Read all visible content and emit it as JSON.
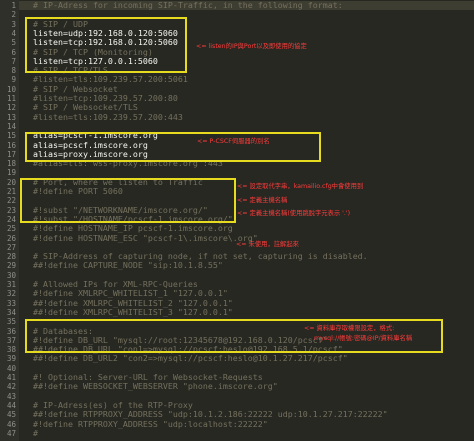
{
  "editor": {
    "lines": [
      {
        "n": "1",
        "text": "# IP-Adress for incoming SIP-Traffic, in the following format:",
        "kind": "comment",
        "highlight": true
      },
      {
        "n": "2",
        "text": "",
        "kind": "comment"
      },
      {
        "n": "3",
        "text": "# SIP / UDP",
        "kind": "comment"
      },
      {
        "n": "4",
        "text": "listen=udp:192.168.0.120:5060",
        "kind": "active"
      },
      {
        "n": "5",
        "text": "listen=tcp:192.168.0.120:5060",
        "kind": "active"
      },
      {
        "n": "6",
        "text": "# SIP / TCP (Monitoring)",
        "kind": "comment"
      },
      {
        "n": "7",
        "text": "listen=tcp:127.0.0.1:5060",
        "kind": "active"
      },
      {
        "n": "8",
        "text": "# SIP / TCP/TLS",
        "kind": "comment"
      },
      {
        "n": "9",
        "text": "#listen=tls:109.239.57.200:5061",
        "kind": "comment"
      },
      {
        "n": "10",
        "text": "# SIP / Websocket",
        "kind": "comment"
      },
      {
        "n": "11",
        "text": "#listen=tcp:109.239.57.200:80",
        "kind": "comment"
      },
      {
        "n": "12",
        "text": "# SIP / Websocket/TLS",
        "kind": "comment"
      },
      {
        "n": "13",
        "text": "#listen=tls:109.239.57.200:443",
        "kind": "comment"
      },
      {
        "n": "14",
        "text": "",
        "kind": "comment"
      },
      {
        "n": "15",
        "text": "alias=pcscf-1.imscore.org",
        "kind": "active"
      },
      {
        "n": "16",
        "text": "alias=pcscf.imscore.org",
        "kind": "active"
      },
      {
        "n": "17",
        "text": "alias=proxy.imscore.org",
        "kind": "active"
      },
      {
        "n": "18",
        "text": "#alias=tls:\"wss-proxy.imscore.org\":443",
        "kind": "comment"
      },
      {
        "n": "19",
        "text": "",
        "kind": "comment"
      },
      {
        "n": "20",
        "text": "# Port, where we listen to Traffic",
        "kind": "comment"
      },
      {
        "n": "21",
        "text": "#!define PORT 5060",
        "kind": "comment"
      },
      {
        "n": "22",
        "text": "",
        "kind": "comment"
      },
      {
        "n": "23",
        "text": "#!subst \"/NETWORKNAME/imscore.org/\"",
        "kind": "comment"
      },
      {
        "n": "24",
        "text": "#!subst \"/HOSTNAME/pcscf-1.imscore.org/\"",
        "kind": "comment"
      },
      {
        "n": "25",
        "text": "#!define HOSTNAME_IP pcscf-1.imscore.org",
        "kind": "comment"
      },
      {
        "n": "26",
        "text": "#!define HOSTNAME_ESC \"pcscf-1\\.imscore\\.org\"",
        "kind": "comment"
      },
      {
        "n": "27",
        "text": "",
        "kind": "comment"
      },
      {
        "n": "28",
        "text": "# SIP-Address of capturing node, if not set, capturing is disabled.",
        "kind": "comment"
      },
      {
        "n": "29",
        "text": "##!define CAPTURE_NODE \"sip:10.1.8.55\"",
        "kind": "comment"
      },
      {
        "n": "30",
        "text": "",
        "kind": "comment"
      },
      {
        "n": "31",
        "text": "# Allowed IPs for XML-RPC-Queries",
        "kind": "comment"
      },
      {
        "n": "32",
        "text": "#!define XMLRPC_WHITELIST_1 \"127.0.0.1\"",
        "kind": "comment"
      },
      {
        "n": "33",
        "text": "##!define XMLRPC_WHITELIST_2 \"127.0.0.1\"",
        "kind": "comment"
      },
      {
        "n": "34",
        "text": "##!define XMLRPC_WHITELIST_3 \"127.0.0.1\"",
        "kind": "comment"
      },
      {
        "n": "35",
        "text": "",
        "kind": "comment"
      },
      {
        "n": "36",
        "text": "# Databases:",
        "kind": "comment"
      },
      {
        "n": "37",
        "text": "#!define DB_URL \"mysql://root:12345678@192.168.0.120/pcscf\"",
        "kind": "comment"
      },
      {
        "n": "38",
        "text": "##!define DB_URL \"con1=>mysql://pcscf:heslo@192.168.5.1/pcscf\"",
        "kind": "comment"
      },
      {
        "n": "39",
        "text": "##!define DB_URL2 \"con2=>mysql://pcscf:heslo@10.1.27.217/pcscf\"",
        "kind": "comment"
      },
      {
        "n": "40",
        "text": "",
        "kind": "comment"
      },
      {
        "n": "41",
        "text": "#! Optional: Server-URL for Websocket-Requests",
        "kind": "comment"
      },
      {
        "n": "42",
        "text": "##!define WEBSOCKET_WEBSERVER \"phone.imscore.org\"",
        "kind": "comment"
      },
      {
        "n": "43",
        "text": "",
        "kind": "comment"
      },
      {
        "n": "44",
        "text": "# IP-Adress(es) of the RTP-Proxy",
        "kind": "comment"
      },
      {
        "n": "45",
        "text": "##!define RTPPROXY_ADDRESS \"udp:10.1.2.186:22222 udp:10.1.27.217:22222\"",
        "kind": "comment"
      },
      {
        "n": "46",
        "text": "#!define RTPPROXY_ADDRESS \"udp:localhost:22222\"",
        "kind": "comment"
      },
      {
        "n": "47",
        "text": "#",
        "kind": "comment"
      }
    ]
  },
  "annotations": {
    "listen_note": "<= listen的IP與Port以及即使用的協定",
    "alias_note": "<= P-CSCF伺服器的別名",
    "subst_note": "<= 設定取代字串，kamailio.cfg中會使用到",
    "hostname_note": "<= 定義主機名稱",
    "hostname_esc_note": "<= 定義主機名稱(使用跳脫字元表示 '.')",
    "capture_note": "<= 未使用，註解起來",
    "db_note_line1": "<= 資料庫存取權限設定，格式:",
    "db_note_line2": "mysql://帳號:密碼@IP/資料庫名稱"
  },
  "colors": {
    "background": "#272822",
    "comment": "#75715e",
    "active": "#f8f8f2",
    "box": "#e6db1f",
    "annotation": "#ff3b3b"
  }
}
